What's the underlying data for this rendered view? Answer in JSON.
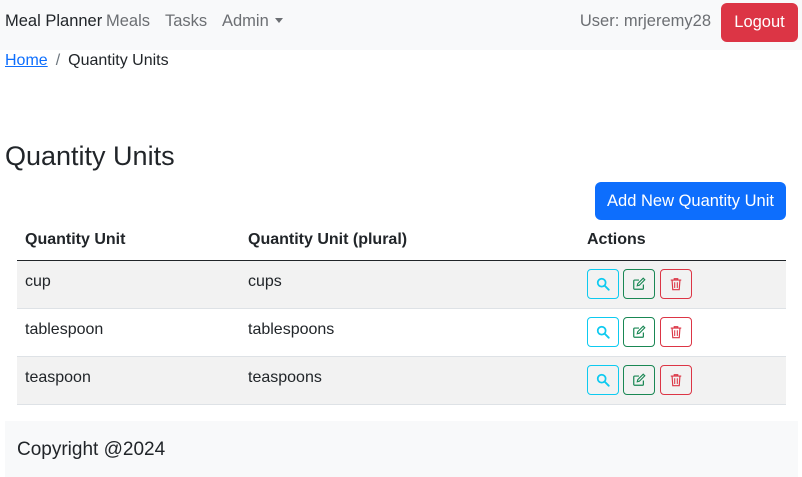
{
  "navbar": {
    "brand": "Meal Planner",
    "links": [
      "Meals",
      "Tasks"
    ],
    "admin_label": "Admin",
    "user_text": "User: mrjeremy28",
    "logout_label": "Logout",
    "logout_color": "#dc3545"
  },
  "breadcrumb": {
    "home": "Home",
    "separator": "/",
    "current": "Quantity Units"
  },
  "page": {
    "title": "Quantity Units",
    "add_button": "Add New Quantity Unit",
    "accent_color": "#0d6efd"
  },
  "table": {
    "headers": [
      "Quantity Unit",
      "Quantity Unit (plural)",
      "Actions"
    ],
    "rows": [
      {
        "unit": "cup",
        "plural": "cups",
        "actions": [
          "search-icon",
          "edit-icon",
          "trash-icon"
        ]
      },
      {
        "unit": "tablespoon",
        "plural": "tablespoons",
        "actions": [
          "search-icon",
          "edit-icon",
          "trash-icon"
        ]
      },
      {
        "unit": "teaspoon",
        "plural": "teaspoons",
        "actions": [
          "search-icon",
          "edit-icon",
          "trash-icon"
        ]
      }
    ]
  },
  "footer": {
    "copyright": "Copyright @2024"
  }
}
